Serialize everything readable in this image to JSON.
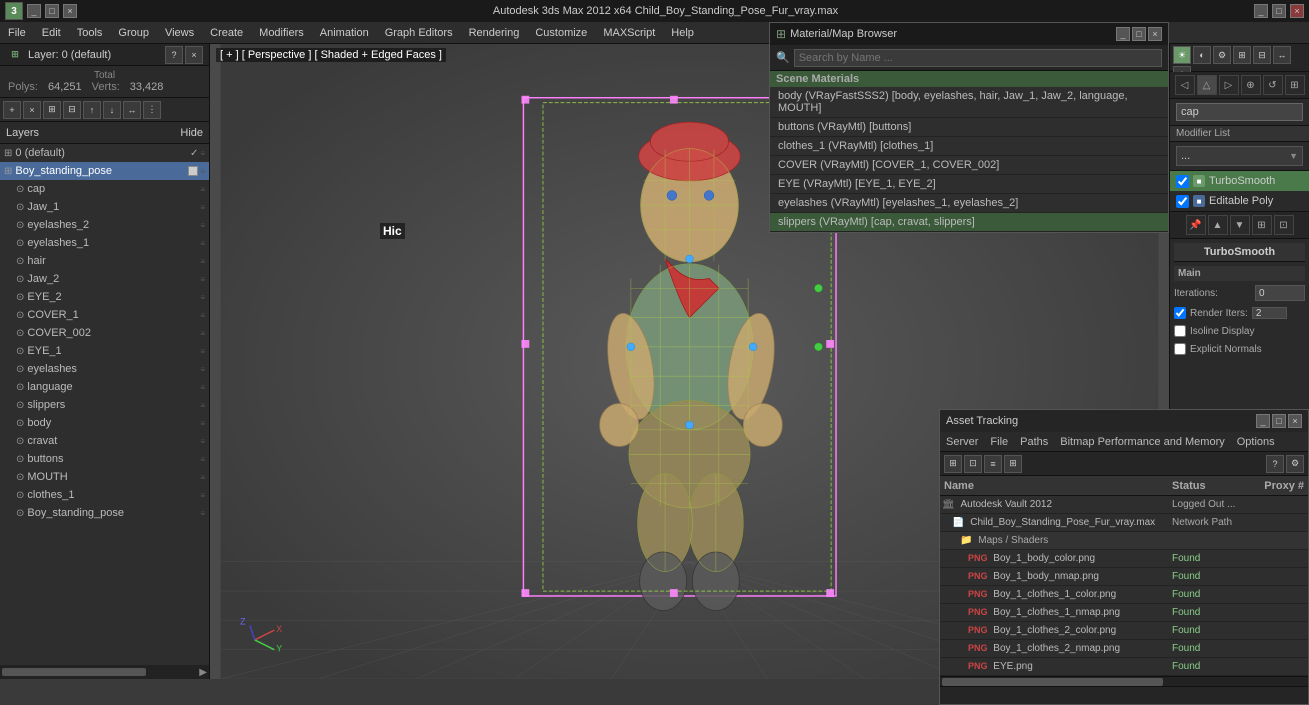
{
  "titlebar": {
    "app_icon": "3dsmax-icon",
    "title": "Autodesk 3ds Max 2012 x64      Child_Boy_Standing_Pose_Fur_vray.max",
    "win_btns": [
      "minimize",
      "maximize",
      "close"
    ]
  },
  "menubar": {
    "items": [
      "File",
      "Edit",
      "Tools",
      "Group",
      "Views",
      "Create",
      "Modifiers",
      "Animation",
      "Graph Editors",
      "Rendering",
      "Customize",
      "MAXScript",
      "Help"
    ]
  },
  "viewport": {
    "label": "[ + ] [ Perspective ] [ Shaded + Edged Faces ]",
    "hic_label": "Hic"
  },
  "stats": {
    "total_label": "Total",
    "polys_label": "Polys:",
    "polys_value": "64,251",
    "verts_label": "Verts:",
    "verts_value": "33,428"
  },
  "layer_panel": {
    "title": "Layer: 0 (default)",
    "layers_label": "Layers",
    "hide_label": "Hide",
    "items": [
      {
        "name": "0 (default)",
        "level": 0,
        "selected": false,
        "check": "✓"
      },
      {
        "name": "Boy_standing_pose",
        "level": 0,
        "selected": true
      },
      {
        "name": "cap",
        "level": 1
      },
      {
        "name": "Jaw_1",
        "level": 1
      },
      {
        "name": "eyelashes_2",
        "level": 1
      },
      {
        "name": "eyelashes_1",
        "level": 1
      },
      {
        "name": "hair",
        "level": 1
      },
      {
        "name": "Jaw_2",
        "level": 1
      },
      {
        "name": "EYE_2",
        "level": 1
      },
      {
        "name": "COVER_1",
        "level": 1
      },
      {
        "name": "COVER_002",
        "level": 1
      },
      {
        "name": "EYE_1",
        "level": 1
      },
      {
        "name": "eyelashes",
        "level": 1
      },
      {
        "name": "language",
        "level": 1
      },
      {
        "name": "slippers",
        "level": 1
      },
      {
        "name": "body",
        "level": 1
      },
      {
        "name": "cravat",
        "level": 1
      },
      {
        "name": "buttons",
        "level": 1
      },
      {
        "name": "MOUTH",
        "level": 1
      },
      {
        "name": "clothes_1",
        "level": 1
      },
      {
        "name": "Boy_standing_pose",
        "level": 1
      }
    ]
  },
  "right_panel": {
    "cap_label": "cap",
    "modifier_list_label": "Modifier List",
    "modifiers": [
      {
        "name": "TurboSmooth",
        "selected": true,
        "color": "green"
      },
      {
        "name": "Editable Poly",
        "selected": false,
        "color": "blue"
      }
    ],
    "turbosmooth_label": "TurboSmooth",
    "main_label": "Main",
    "iterations_label": "Iterations:",
    "iterations_value": "0",
    "render_iters_label": "Render Iters:",
    "render_iters_value": "2",
    "isoline_label": "Isoline Display",
    "explicit_normals_label": "Explicit Normals"
  },
  "material_browser": {
    "title": "Material/Map Browser",
    "search_placeholder": "Search by Name ...",
    "section_label": "Scene Materials",
    "materials": [
      {
        "name": "body (VRayFastSSS2) [body, eyelashes, hair, Jaw_1, Jaw_2, language, MOUTH]"
      },
      {
        "name": "buttons (VRayMtl) [buttons]"
      },
      {
        "name": "clothes_1 (VRayMtl) [clothes_1]"
      },
      {
        "name": "COVER (VRayMtl) [COVER_1, COVER_002]"
      },
      {
        "name": "EYE (VRayMtl) [EYE_1, EYE_2]"
      },
      {
        "name": "eyelashes (VRayMtl) [eyelashes_1, eyelashes_2]"
      },
      {
        "name": "slippers (VRayMtl) [cap, cravat, slippers]",
        "selected": true
      }
    ]
  },
  "asset_tracking": {
    "title": "Asset Tracking",
    "menu_items": [
      "Server",
      "File",
      "Paths",
      "Bitmap Performance and Memory",
      "Options"
    ],
    "columns": {
      "name": "Name",
      "status": "Status",
      "proxy": "Proxy #"
    },
    "rows": [
      {
        "type": "vault",
        "icon": "🏛",
        "name": "Autodesk Vault 2012",
        "status": "Logged Out ...",
        "proxy": ""
      },
      {
        "type": "file",
        "icon": "📄",
        "name": "Child_Boy_Standing_Pose_Fur_vray.max",
        "status": "Network Path",
        "proxy": ""
      },
      {
        "type": "folder",
        "icon": "📁",
        "name": "Maps / Shaders",
        "status": "",
        "proxy": ""
      },
      {
        "type": "png",
        "icon": "🖼",
        "name": "Boy_1_body_color.png",
        "status": "Found",
        "proxy": ""
      },
      {
        "type": "png",
        "icon": "🖼",
        "name": "Boy_1_body_nmap.png",
        "status": "Found",
        "proxy": ""
      },
      {
        "type": "png",
        "icon": "🖼",
        "name": "Boy_1_clothes_1_color.png",
        "status": "Found",
        "proxy": ""
      },
      {
        "type": "png",
        "icon": "🖼",
        "name": "Boy_1_clothes_1_nmap.png",
        "status": "Found",
        "proxy": ""
      },
      {
        "type": "png",
        "icon": "🖼",
        "name": "Boy_1_clothes_2_color.png",
        "status": "Found",
        "proxy": ""
      },
      {
        "type": "png",
        "icon": "🖼",
        "name": "Boy_1_clothes_2_nmap.png",
        "status": "Found",
        "proxy": ""
      },
      {
        "type": "png",
        "icon": "🖼",
        "name": "EYE.png",
        "status": "Found",
        "proxy": ""
      }
    ]
  },
  "colors": {
    "bg": "#3a3a3a",
    "panel_bg": "#2e2e2e",
    "titlebar_bg": "#1a1a1a",
    "selected_blue": "#4a6a9a",
    "selected_green": "#3a5a3a",
    "accent_green": "#6a9a6a"
  }
}
